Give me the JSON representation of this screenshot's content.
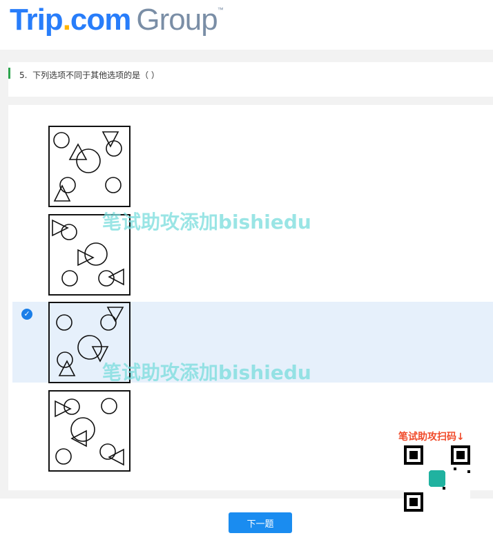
{
  "header": {
    "logo": {
      "part1": "Trip",
      "dot": ".",
      "part2": "com",
      "group": "Group",
      "tm": "™"
    }
  },
  "question": {
    "number": "5.",
    "text": "下列选项不同于其他选项的是（ ）"
  },
  "options": [
    {
      "selected": false
    },
    {
      "selected": false
    },
    {
      "selected": true
    },
    {
      "selected": false
    }
  ],
  "watermark": "笔试助攻添加bishiedu",
  "promo": {
    "label": "笔试助攻扫码↓"
  },
  "footer": {
    "next_label": "下一题"
  },
  "colors": {
    "accent": "#1a8cf0",
    "selected_bg": "#e6f0fb",
    "bar": "#2da44e"
  }
}
